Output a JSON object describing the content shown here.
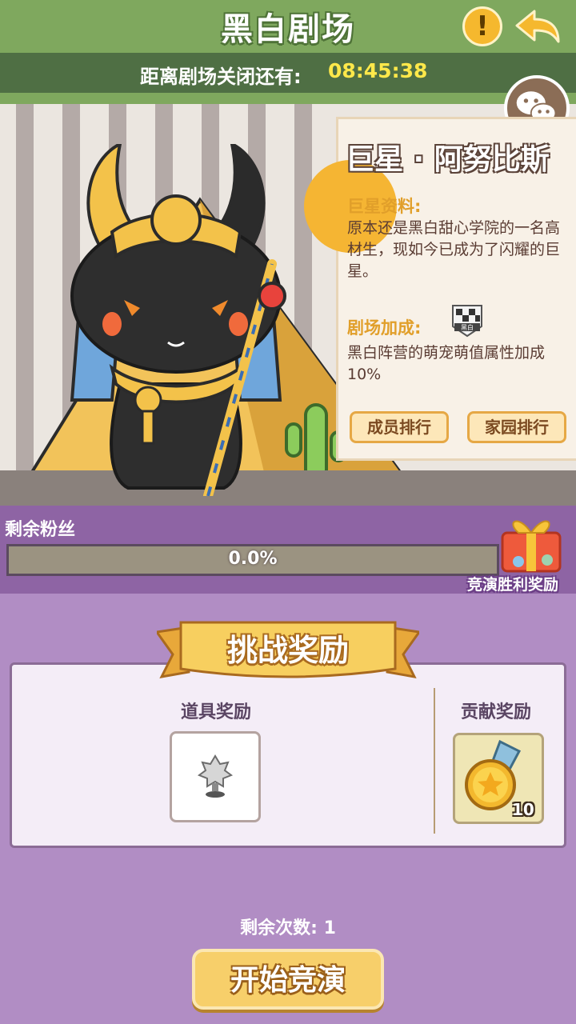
{
  "header": {
    "title": "黑白剧场",
    "info_icon": "exclamation-icon",
    "info_glyph": "!",
    "back_icon": "back-arrow-icon",
    "timer_label": "距离剧场关闭还有:",
    "timer_value": "08:45:38"
  },
  "scene": {
    "chat_icon": "wechat-icon",
    "character": "anubis-cat",
    "star_name": "巨星 · 阿努比斯",
    "profile_heading": "巨星资料:",
    "profile_text": "原本还是黑白甜心学院的一名高材生，现如今已成为了闪耀的巨星。",
    "bonus_heading": "剧场加成:",
    "bonus_badge_text": "黑白",
    "bonus_text": "黑白阵营的萌宠萌值属性加成10%",
    "member_rank_label": "成员排行",
    "home_rank_label": "家园排行"
  },
  "fans": {
    "label": "剩余粉丝",
    "progress": 0.0,
    "progress_text": "0.0%",
    "gift_label": "竞演胜利奖励"
  },
  "rewards": {
    "title": "挑战奖励",
    "item_heading": "道具奖励",
    "contrib_heading": "贡献奖励",
    "item_icon": "trophy-icon",
    "medal_icon": "star-medal-icon",
    "medal_count": "10"
  },
  "footer": {
    "remaining": "剩余次数: 1",
    "start_label": "开始竞演"
  },
  "colors": {
    "header_green": "#7fa85e",
    "timer_yellow": "#ffe84a",
    "panel_purple": "#b18dc4",
    "gold": "#f5b533"
  }
}
